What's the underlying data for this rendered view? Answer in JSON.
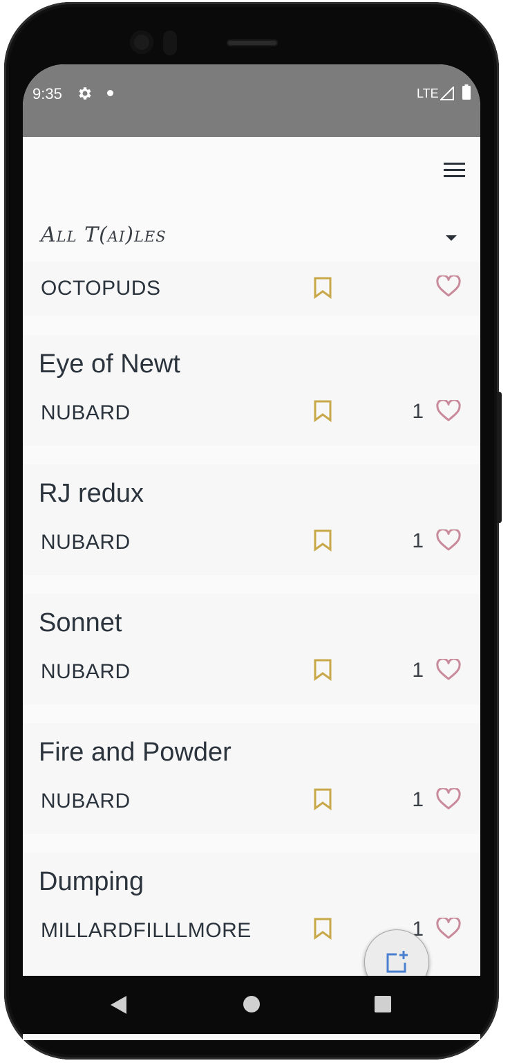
{
  "status_bar": {
    "time": "9:35",
    "network": "LTE",
    "icons": [
      "gear-icon",
      "dot-icon",
      "signal-icon",
      "battery-icon"
    ],
    "background": "#7c7c7c"
  },
  "header": {
    "menu_icon": "hamburger-menu-icon"
  },
  "filter": {
    "label": "All T(ai)les",
    "dropdown_icon": "dropdown-arrow-icon"
  },
  "tales": [
    {
      "title": "",
      "author": "OCTOPUDS",
      "likes": ""
    },
    {
      "title": "Eye of Newt",
      "author": "NUBARD",
      "likes": "1"
    },
    {
      "title": "RJ redux",
      "author": "NUBARD",
      "likes": "1"
    },
    {
      "title": "Sonnet",
      "author": "NUBARD",
      "likes": "1"
    },
    {
      "title": "Fire and Powder",
      "author": "NUBARD",
      "likes": "1"
    },
    {
      "title": "Dumping",
      "author": "MILLARDFILLLMORE",
      "likes": "1"
    }
  ],
  "colors": {
    "bookmark": "#c9a84a",
    "heart": "#c98a9c",
    "fab_icon": "#4a7fd0",
    "text": "#2b333c"
  },
  "fab": {
    "icon": "add-tale-icon"
  },
  "nav_bar": {
    "icons": [
      "back-icon",
      "home-icon",
      "recents-icon"
    ]
  }
}
